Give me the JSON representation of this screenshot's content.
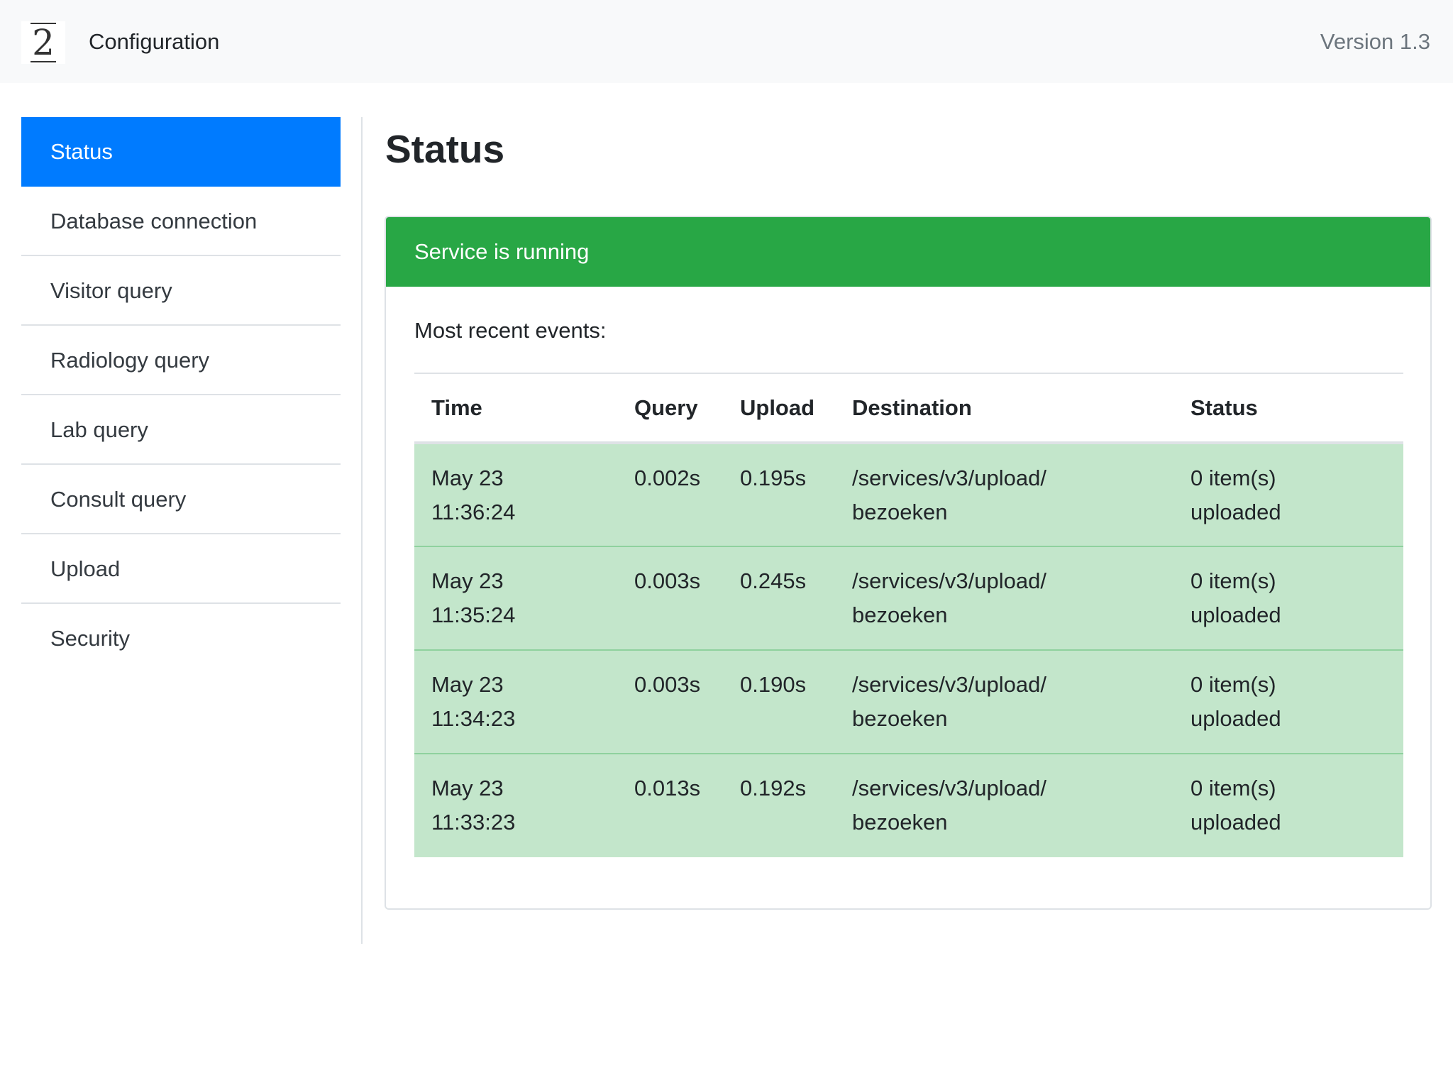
{
  "header": {
    "logo_text": "2",
    "title": "Configuration",
    "version": "Version 1.3"
  },
  "sidebar": {
    "items": [
      {
        "label": "Status",
        "active": true
      },
      {
        "label": "Database connection",
        "active": false
      },
      {
        "label": "Visitor query",
        "active": false
      },
      {
        "label": "Radiology query",
        "active": false
      },
      {
        "label": "Lab query",
        "active": false
      },
      {
        "label": "Consult query",
        "active": false
      },
      {
        "label": "Upload",
        "active": false
      },
      {
        "label": "Security",
        "active": false
      }
    ]
  },
  "main": {
    "title": "Status",
    "card": {
      "header": "Service is running",
      "header_color": "#28a745",
      "recent_label": "Most recent events:",
      "table": {
        "columns": [
          "Time",
          "Query",
          "Upload",
          "Destination",
          "Status"
        ],
        "rows": [
          {
            "time_date": "May 23",
            "time_clock": "11:36:24",
            "query": "0.002s",
            "upload": "0.195s",
            "dest_line1": "/services/v3/upload/",
            "dest_line2": "bezoeken",
            "status_line1": "0 item(s)",
            "status_line2": "uploaded"
          },
          {
            "time_date": "May 23",
            "time_clock": "11:35:24",
            "query": "0.003s",
            "upload": "0.245s",
            "dest_line1": "/services/v3/upload/",
            "dest_line2": "bezoeken",
            "status_line1": "0 item(s)",
            "status_line2": "uploaded"
          },
          {
            "time_date": "May 23",
            "time_clock": "11:34:23",
            "query": "0.003s",
            "upload": "0.190s",
            "dest_line1": "/services/v3/upload/",
            "dest_line2": "bezoeken",
            "status_line1": "0 item(s)",
            "status_line2": "uploaded"
          },
          {
            "time_date": "May 23",
            "time_clock": "11:33:23",
            "query": "0.013s",
            "upload": "0.192s",
            "dest_line1": "/services/v3/upload/",
            "dest_line2": "bezoeken",
            "status_line1": "0 item(s)",
            "status_line2": "uploaded"
          }
        ],
        "row_color": "#c3e6cb"
      }
    }
  },
  "colors": {
    "accent": "#007bff",
    "success": "#28a745",
    "topbar": "#f8f9fa"
  }
}
